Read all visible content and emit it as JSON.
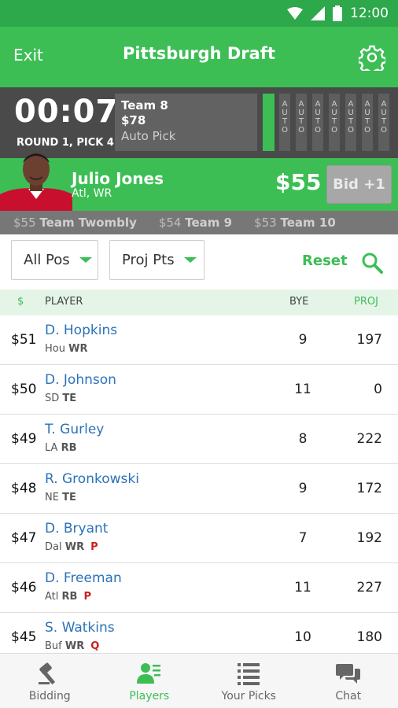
{
  "status_bar": {
    "time": "12:00",
    "icons": [
      "wifi-icon",
      "cell-signal-icon",
      "battery-icon"
    ]
  },
  "app_bar": {
    "exit_label": "Exit",
    "title": "Pittsburgh Draft",
    "settings_icon": "gear-icon"
  },
  "timer": {
    "clock": "00:07",
    "round_label": "ROUND 1, PICK 4",
    "pick_card": {
      "team": "Team 8",
      "price": "$78",
      "mode": "Auto Pick"
    },
    "auto_slots": [
      "AUTO",
      "AUTO",
      "AUTO",
      "AUTO",
      "AUTO",
      "AUTO",
      "AUTO"
    ]
  },
  "current_player": {
    "name": "Julio Jones",
    "team_pos": "Atl, WR",
    "price": "$55",
    "bid_label": "Bid +1"
  },
  "recent_bids": [
    {
      "amount": "$55",
      "team": "Team Twombly"
    },
    {
      "amount": "$54",
      "team": "Team 9"
    },
    {
      "amount": "$53",
      "team": "Team 10"
    }
  ],
  "filters": {
    "position": "All Pos",
    "sort": "Proj Pts",
    "reset_label": "Reset",
    "search_icon": "search-icon"
  },
  "table": {
    "headers": {
      "price": "$",
      "player": "PLAYER",
      "bye": "BYE",
      "proj": "PROJ"
    },
    "rows": [
      {
        "price": "$51",
        "name": "D. Hopkins",
        "team": "Hou",
        "pos": "WR",
        "flag": "",
        "bye": "9",
        "proj": "197"
      },
      {
        "price": "$50",
        "name": "D. Johnson",
        "team": "SD",
        "pos": "TE",
        "flag": "",
        "bye": "11",
        "proj": "0"
      },
      {
        "price": "$49",
        "name": "T. Gurley",
        "team": "LA",
        "pos": "RB",
        "flag": "",
        "bye": "8",
        "proj": "222"
      },
      {
        "price": "$48",
        "name": "R. Gronkowski",
        "team": "NE",
        "pos": "TE",
        "flag": "",
        "bye": "9",
        "proj": "172"
      },
      {
        "price": "$47",
        "name": "D. Bryant",
        "team": "Dal",
        "pos": "WR",
        "flag": "P",
        "bye": "7",
        "proj": "192"
      },
      {
        "price": "$46",
        "name": "D. Freeman",
        "team": "Atl",
        "pos": "RB",
        "flag": "P",
        "bye": "11",
        "proj": "227"
      },
      {
        "price": "$45",
        "name": "S. Watkins",
        "team": "Buf",
        "pos": "WR",
        "flag": "Q",
        "bye": "10",
        "proj": "180"
      }
    ]
  },
  "bottom_nav": [
    {
      "label": "Bidding",
      "icon": "gavel-icon",
      "active": false
    },
    {
      "label": "Players",
      "icon": "player-list-icon",
      "active": true
    },
    {
      "label": "Your Picks",
      "icon": "list-icon",
      "active": false
    },
    {
      "label": "Chat",
      "icon": "chat-icon",
      "active": false
    }
  ],
  "colors": {
    "brand_green": "#3cbe55",
    "status_green": "#2da84a",
    "dark_gray": "#4a4a4a",
    "link_blue": "#2b72b8",
    "flag_red": "#cc1f1f"
  }
}
